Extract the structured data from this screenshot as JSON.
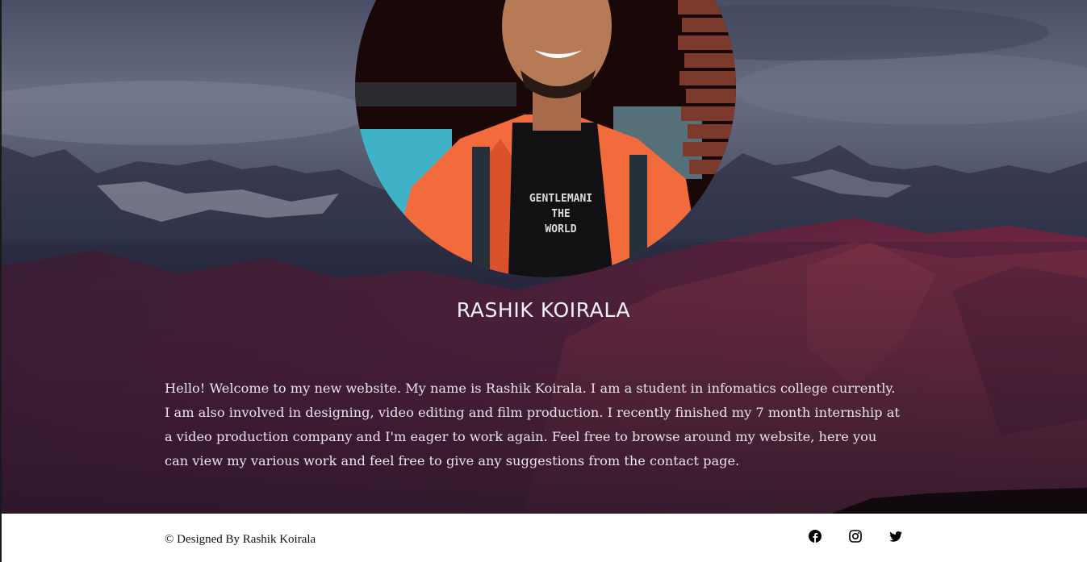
{
  "profile": {
    "name": "RASHIK KOIRALA",
    "bio": "Hello! Welcome to my new website. My name is Rashik Koirala. I am a student in infomatics college currently. I am also involved in designing, video editing and film production. I recently finished my 7 month internship at a video production company and I'm eager to work again. Feel free to browse around my website, here you can view my various work and feel free to give any suggestions from the contact page.",
    "shirt_text": [
      "GENTLEMANI",
      "THE",
      "WORLD"
    ]
  },
  "footer": {
    "copyright": "© Designed By Rashik Koirala",
    "socials": [
      {
        "name": "facebook",
        "icon": "facebook-icon"
      },
      {
        "name": "instagram",
        "icon": "instagram-icon"
      },
      {
        "name": "twitter",
        "icon": "twitter-icon"
      }
    ]
  },
  "colors": {
    "sky": "#5b6075",
    "mountains": "#6b2a40",
    "jacket": "#f36a3c",
    "footer_bg": "#ffffff",
    "text_light": "#f2f2f2"
  }
}
